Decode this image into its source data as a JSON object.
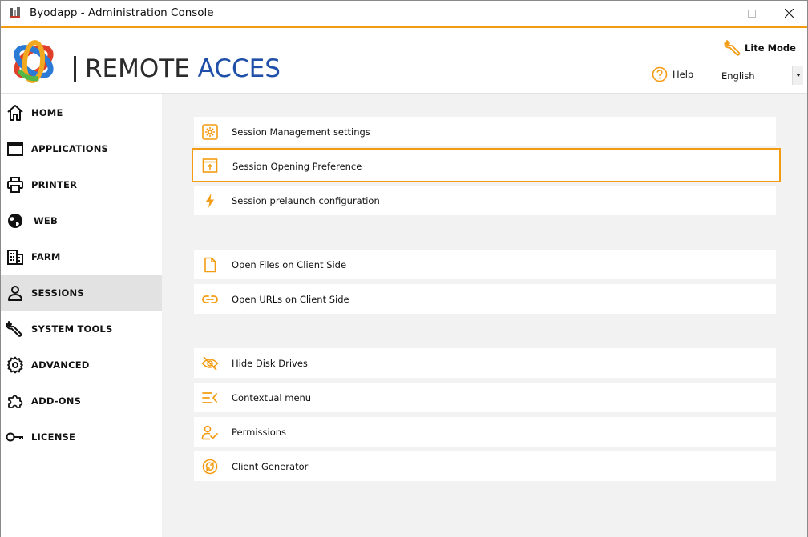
{
  "window": {
    "title": "Byodapp - Administration Console",
    "accent_color": "#f39c12",
    "controls": [
      "minimize",
      "maximize",
      "close"
    ]
  },
  "header": {
    "brand_left": "REMOTE ",
    "brand_right": "ACCES",
    "lite_mode_label": "Lite Mode",
    "help_label": "Help",
    "language_value": "English"
  },
  "sidebar": {
    "items": [
      {
        "label": "HOME",
        "icon": "home-icon",
        "active": false
      },
      {
        "label": "APPLICATIONS",
        "icon": "window-icon",
        "active": false
      },
      {
        "label": "PRINTER",
        "icon": "printer-icon",
        "active": false
      },
      {
        "label": "WEB",
        "icon": "globe-icon",
        "active": false
      },
      {
        "label": "FARM",
        "icon": "building-icon",
        "active": false
      },
      {
        "label": "SESSIONS",
        "icon": "user-icon",
        "active": true
      },
      {
        "label": "SYSTEM TOOLS",
        "icon": "wrench-icon",
        "active": false
      },
      {
        "label": "ADVANCED",
        "icon": "gear-icon",
        "active": false
      },
      {
        "label": "ADD-ONS",
        "icon": "puzzle-icon",
        "active": false
      },
      {
        "label": "LICENSE",
        "icon": "key-icon",
        "active": false
      }
    ]
  },
  "main": {
    "items": [
      {
        "label": "Session Management settings",
        "icon": "settings-box-icon"
      },
      {
        "label": "Session Opening Preference",
        "icon": "open-window-icon",
        "selected": true
      },
      {
        "label": "Session prelaunch configuration",
        "icon": "lightning-icon"
      },
      {
        "label": "Open Files on Client Side",
        "icon": "file-icon"
      },
      {
        "label": "Open URLs on Client Side",
        "icon": "link-icon"
      },
      {
        "label": "Hide Disk Drives",
        "icon": "eye-off-icon"
      },
      {
        "label": "Contextual menu",
        "icon": "menu-icon"
      },
      {
        "label": "Permissions",
        "icon": "user-check-icon"
      },
      {
        "label": "Client Generator",
        "icon": "refresh-circle-icon"
      }
    ]
  }
}
